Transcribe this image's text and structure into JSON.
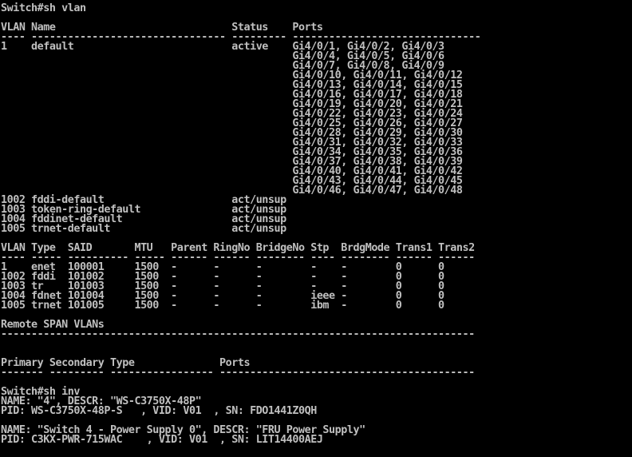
{
  "window": {
    "background": "#000000",
    "text_color": "#c0c0c0"
  },
  "lines": [
    "Switch#sh vlan",
    "",
    "VLAN Name                             Status    Ports",
    "---- -------------------------------- --------- -------------------------------",
    "1    default                          active    Gi4/0/1, Gi4/0/2, Gi4/0/3",
    "                                                Gi4/0/4, Gi4/0/5, Gi4/0/6",
    "                                                Gi4/0/7, Gi4/0/8, Gi4/0/9",
    "                                                Gi4/0/10, Gi4/0/11, Gi4/0/12",
    "                                                Gi4/0/13, Gi4/0/14, Gi4/0/15",
    "                                                Gi4/0/16, Gi4/0/17, Gi4/0/18",
    "                                                Gi4/0/19, Gi4/0/20, Gi4/0/21",
    "                                                Gi4/0/22, Gi4/0/23, Gi4/0/24",
    "                                                Gi4/0/25, Gi4/0/26, Gi4/0/27",
    "                                                Gi4/0/28, Gi4/0/29, Gi4/0/30",
    "                                                Gi4/0/31, Gi4/0/32, Gi4/0/33",
    "                                                Gi4/0/34, Gi4/0/35, Gi4/0/36",
    "                                                Gi4/0/37, Gi4/0/38, Gi4/0/39",
    "                                                Gi4/0/40, Gi4/0/41, Gi4/0/42",
    "                                                Gi4/0/43, Gi4/0/44, Gi4/0/45",
    "                                                Gi4/0/46, Gi4/0/47, Gi4/0/48",
    "1002 fddi-default                     act/unsup",
    "1003 token-ring-default               act/unsup",
    "1004 fddinet-default                  act/unsup",
    "1005 trnet-default                    act/unsup",
    "",
    "VLAN Type  SAID       MTU   Parent RingNo BridgeNo Stp  BrdgMode Trans1 Trans2",
    "---- ----- ---------- ----- ------ ------ -------- ---- -------- ------ ------",
    "1    enet  100001     1500  -      -      -        -    -        0      0",
    "1002 fddi  101002     1500  -      -      -        -    -        0      0",
    "1003 tr    101003     1500  -      -      -        -    -        0      0",
    "1004 fdnet 101004     1500  -      -      -        ieee -        0      0",
    "1005 trnet 101005     1500  -      -      -        ibm  -        0      0",
    "",
    "Remote SPAN VLANs",
    "------------------------------------------------------------------------------",
    "",
    "",
    "Primary Secondary Type              Ports",
    "------- --------- ----------------- ------------------------------------------",
    "",
    "Switch#sh inv",
    "NAME: \"4\", DESCR: \"WS-C3750X-48P\"",
    "PID: WS-C3750X-48P-S   , VID: V01  , SN: FDO1441Z0QH",
    "",
    "NAME: \"Switch 4 - Power Supply 0\", DESCR: \"FRU Power Supply\"",
    "PID: C3KX-PWR-715WAC    , VID: V01  , SN: LIT14400AEJ"
  ]
}
